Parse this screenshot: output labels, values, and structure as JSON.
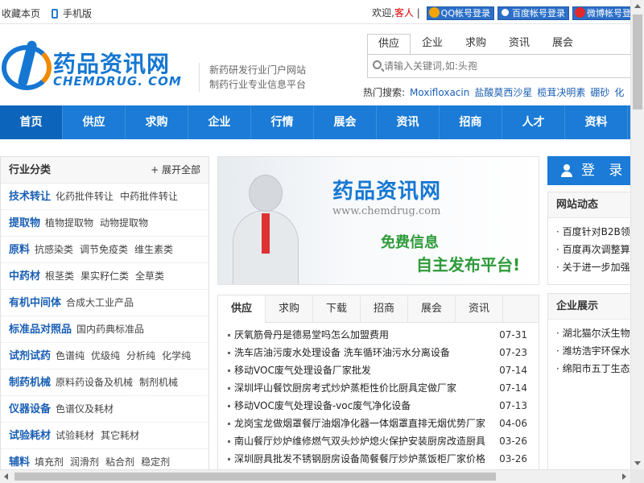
{
  "topbar": {
    "bookmark": "收藏本页",
    "mobile": "手机版",
    "welcome": "欢迎,",
    "guest": "客人",
    "sep": "|",
    "qq_login": "QQ帐号登录",
    "baidu_login": "百度帐号登录",
    "weibo_login": "微博帐号登录"
  },
  "header": {
    "logo_cn": "药品资讯网",
    "logo_en": "CHEMDRUG. COM",
    "slogan1": "新药研发行业门户网站",
    "slogan2": "制药行业专业信息平台"
  },
  "search": {
    "tabs": [
      "供应",
      "企业",
      "求购",
      "资讯",
      "展会"
    ],
    "placeholder": "请输入关键词,如:头孢",
    "hot_label": "热门搜索:",
    "hot": [
      "Moxifloxacin",
      "盐酸莫西沙星",
      "榄茸决明素",
      "硼砂",
      "化"
    ]
  },
  "nav": [
    "首页",
    "供应",
    "求购",
    "企业",
    "行情",
    "展会",
    "资讯",
    "招商",
    "人才",
    "资料"
  ],
  "category": {
    "title": "行业分类",
    "expand": "+ 展开全部",
    "rows": [
      {
        "h": "技术转让",
        "s": [
          "化药批件转让",
          "中药批件转让"
        ]
      },
      {
        "h": "提取物",
        "s": [
          "植物提取物",
          "动物提取物"
        ]
      },
      {
        "h": "原料",
        "s": [
          "抗感染类",
          "调节免疫类",
          "维生素类"
        ]
      },
      {
        "h": "中药材",
        "s": [
          "根茎类",
          "果实籽仁类",
          "全草类"
        ]
      },
      {
        "h": "有机中间体",
        "s": [
          "合成大工业产品"
        ]
      },
      {
        "h": "标准品对照品",
        "s": [
          "国内药典标准品"
        ]
      },
      {
        "h": "试剂试药",
        "s": [
          "色谱纯",
          "优级纯",
          "分析纯",
          "化学纯"
        ]
      },
      {
        "h": "制药机械",
        "s": [
          "原料药设备及机械",
          "制剂机械"
        ]
      },
      {
        "h": "仪器设备",
        "s": [
          "色谱仪及耗材"
        ]
      },
      {
        "h": "试验耗材",
        "s": [
          "试验耗材",
          "其它耗材"
        ]
      },
      {
        "h": "辅料",
        "s": [
          "填充剂",
          "润滑剂",
          "粘合剂",
          "稳定剂"
        ]
      }
    ]
  },
  "banner": {
    "title": "药品资讯网",
    "url": "www.chemdrug.com",
    "line1": "免费信息",
    "line2": "自主发布平台!"
  },
  "info": {
    "tabs": [
      "供应",
      "求购",
      "下载",
      "招商",
      "展会",
      "资讯"
    ],
    "items": [
      {
        "t": "厌氧筋骨丹是德易堂吗怎么加盟费用",
        "d": "07-31"
      },
      {
        "t": "洗车店油污废水处理设备 洗车循环油污水分离设备",
        "d": "07-23"
      },
      {
        "t": "移动VOC废气处理设备厂家批发",
        "d": "07-14"
      },
      {
        "t": "深圳坪山餐饮厨房考式炒炉蒸柜性价比厨具定做厂家",
        "d": "07-14"
      },
      {
        "t": "移动VOC废气处理设备-voc废气净化设备",
        "d": "07-13"
      },
      {
        "t": "龙岗宝龙做烟罩餐厅油烟净化器一体烟罩直排无烟优势厂家",
        "d": "04-06"
      },
      {
        "t": "南山餐厅炒炉维修燃气双头炒炉熄火保护安装厨房改造厨具",
        "d": "03-26"
      },
      {
        "t": "深圳厨具批发不锈钢厨房设备简餐餐厅炒炉蒸饭柜厂家价格",
        "d": "03-26"
      }
    ]
  },
  "right": {
    "login": "登 录",
    "news_title": "网站动态",
    "news": [
      "百度针对B2B领",
      "百度再次调整算",
      "关于进一步加强"
    ],
    "company_title": "企业展示",
    "companies": [
      "湖北猫尔沃生物",
      "潍坊浩宇环保水",
      "绵阳市五丁生态"
    ]
  }
}
